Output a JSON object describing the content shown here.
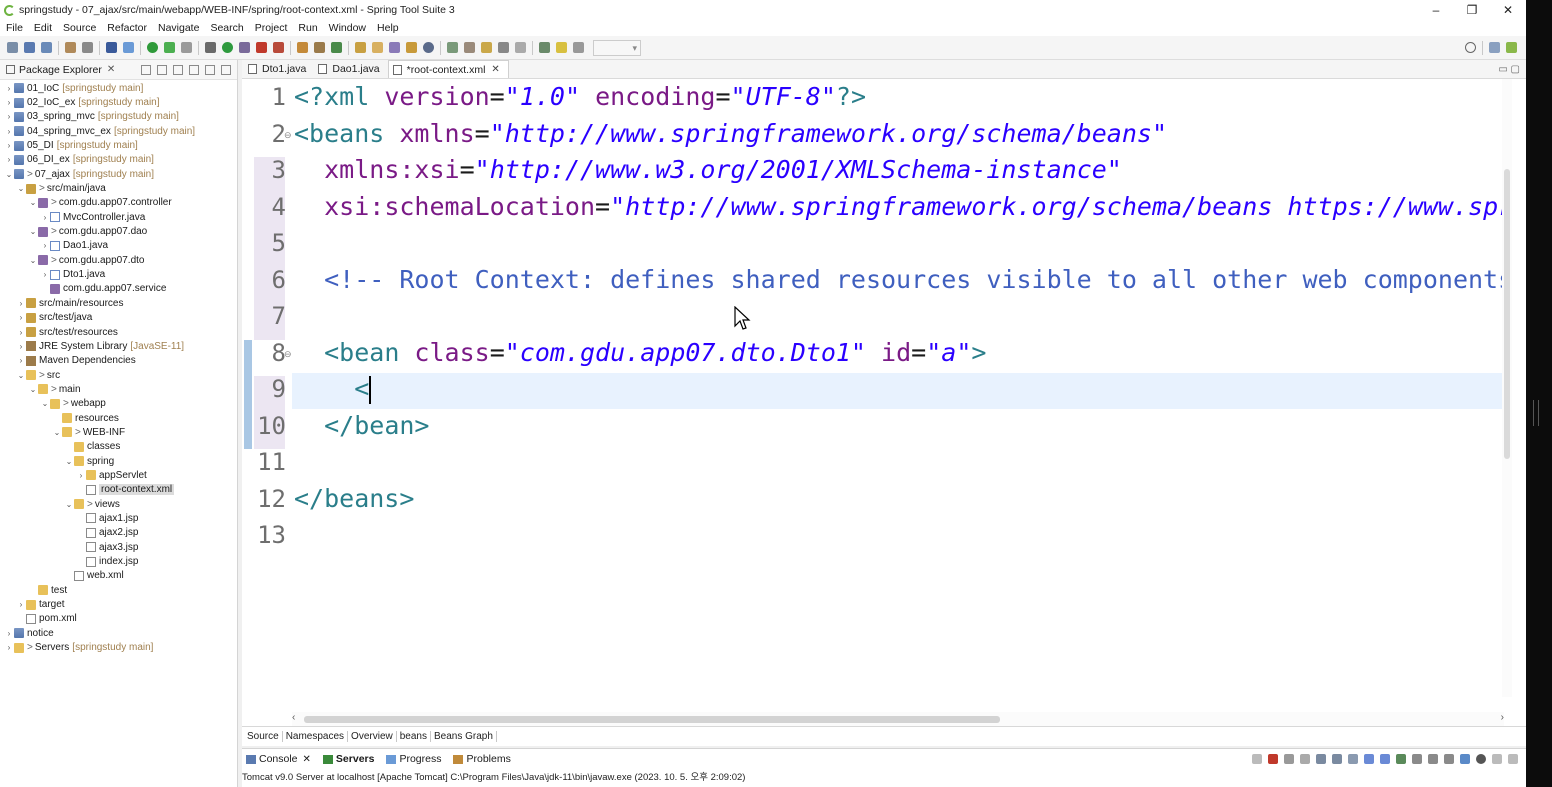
{
  "window": {
    "title": "springstudy - 07_ajax/src/main/webapp/WEB-INF/spring/root-context.xml - Spring Tool Suite 3",
    "minimize": "–",
    "restore": "❐",
    "close": "✕"
  },
  "menu": [
    "File",
    "Edit",
    "Source",
    "Refactor",
    "Navigate",
    "Search",
    "Project",
    "Run",
    "Window",
    "Help"
  ],
  "explorer": {
    "title": "Package Explorer",
    "tree": [
      {
        "label": "01_IoC",
        "ann": "[springstudy main]",
        "indent": 0,
        "arrow": ">",
        "icon": "proj"
      },
      {
        "label": "02_IoC_ex",
        "ann": "[springstudy main]",
        "indent": 0,
        "arrow": ">",
        "icon": "proj"
      },
      {
        "label": "03_spring_mvc",
        "ann": "[springstudy main]",
        "indent": 0,
        "arrow": ">",
        "icon": "proj"
      },
      {
        "label": "04_spring_mvc_ex",
        "ann": "[springstudy main]",
        "indent": 0,
        "arrow": ">",
        "icon": "proj"
      },
      {
        "label": "05_DI",
        "ann": "[springstudy main]",
        "indent": 0,
        "arrow": ">",
        "icon": "proj"
      },
      {
        "label": "06_DI_ex",
        "ann": "[springstudy main]",
        "indent": 0,
        "arrow": ">",
        "icon": "proj"
      },
      {
        "label": "07_ajax",
        "deco": ">",
        "ann": "[springstudy main]",
        "indent": 0,
        "arrow": "v",
        "icon": "proj"
      },
      {
        "label": "src/main/java",
        "deco": ">",
        "ann": "",
        "indent": 1,
        "arrow": "v",
        "icon": "srcfolder"
      },
      {
        "label": "com.gdu.app07.controller",
        "deco": ">",
        "ann": "",
        "indent": 2,
        "arrow": "v",
        "icon": "pkg"
      },
      {
        "label": "MvcController.java",
        "ann": "",
        "indent": 3,
        "arrow": ">",
        "icon": "java"
      },
      {
        "label": "com.gdu.app07.dao",
        "deco": ">",
        "ann": "",
        "indent": 2,
        "arrow": "v",
        "icon": "pkg"
      },
      {
        "label": "Dao1.java",
        "ann": "",
        "indent": 3,
        "arrow": ">",
        "icon": "java"
      },
      {
        "label": "com.gdu.app07.dto",
        "deco": ">",
        "ann": "",
        "indent": 2,
        "arrow": "v",
        "icon": "pkg"
      },
      {
        "label": "Dto1.java",
        "ann": "",
        "indent": 3,
        "arrow": ">",
        "icon": "java"
      },
      {
        "label": "com.gdu.app07.service",
        "ann": "",
        "indent": 3,
        "arrow": "",
        "icon": "pkg"
      },
      {
        "label": "src/main/resources",
        "ann": "",
        "indent": 1,
        "arrow": ">",
        "icon": "srcfolder"
      },
      {
        "label": "src/test/java",
        "ann": "",
        "indent": 1,
        "arrow": ">",
        "icon": "srcfolder"
      },
      {
        "label": "src/test/resources",
        "ann": "",
        "indent": 1,
        "arrow": ">",
        "icon": "srcfolder"
      },
      {
        "label": "JRE System Library",
        "ann": "[JavaSE-11]",
        "indent": 1,
        "arrow": ">",
        "icon": "jar"
      },
      {
        "label": "Maven Dependencies",
        "ann": "",
        "indent": 1,
        "arrow": ">",
        "icon": "jar"
      },
      {
        "label": "src",
        "deco": ">",
        "ann": "",
        "indent": 1,
        "arrow": "v",
        "icon": "folder"
      },
      {
        "label": "main",
        "deco": ">",
        "ann": "",
        "indent": 2,
        "arrow": "v",
        "icon": "folder"
      },
      {
        "label": "webapp",
        "deco": ">",
        "ann": "",
        "indent": 3,
        "arrow": "v",
        "icon": "folder"
      },
      {
        "label": "resources",
        "ann": "",
        "indent": 4,
        "arrow": "",
        "icon": "folder"
      },
      {
        "label": "WEB-INF",
        "deco": ">",
        "ann": "",
        "indent": 4,
        "arrow": "v",
        "icon": "folder"
      },
      {
        "label": "classes",
        "ann": "",
        "indent": 5,
        "arrow": "",
        "icon": "folder"
      },
      {
        "label": "spring",
        "ann": "",
        "indent": 5,
        "arrow": "v",
        "icon": "folder"
      },
      {
        "label": "appServlet",
        "ann": "",
        "indent": 6,
        "arrow": ">",
        "icon": "folder"
      },
      {
        "label": "root-context.xml",
        "ann": "",
        "indent": 6,
        "arrow": "",
        "icon": "xml",
        "selected": true
      },
      {
        "label": "views",
        "deco": ">",
        "ann": "",
        "indent": 5,
        "arrow": "v",
        "icon": "folder"
      },
      {
        "label": "ajax1.jsp",
        "ann": "",
        "indent": 6,
        "arrow": "",
        "icon": "file"
      },
      {
        "label": "ajax2.jsp",
        "ann": "",
        "indent": 6,
        "arrow": "",
        "icon": "file"
      },
      {
        "label": "ajax3.jsp",
        "ann": "",
        "indent": 6,
        "arrow": "",
        "icon": "file"
      },
      {
        "label": "index.jsp",
        "ann": "",
        "indent": 6,
        "arrow": "",
        "icon": "file"
      },
      {
        "label": "web.xml",
        "ann": "",
        "indent": 5,
        "arrow": "",
        "icon": "xml"
      },
      {
        "label": "test",
        "ann": "",
        "indent": 2,
        "arrow": "",
        "icon": "folder"
      },
      {
        "label": "target",
        "ann": "",
        "indent": 1,
        "arrow": ">",
        "icon": "folder"
      },
      {
        "label": "pom.xml",
        "ann": "",
        "indent": 1,
        "arrow": "",
        "icon": "xml"
      },
      {
        "label": "notice",
        "ann": "",
        "indent": 0,
        "arrow": ">",
        "icon": "proj"
      },
      {
        "label": "Servers",
        "deco": ">",
        "ann": "[springstudy main]",
        "indent": 0,
        "arrow": ">",
        "icon": "folder"
      }
    ]
  },
  "editor": {
    "tabs": [
      {
        "label": "Dto1.java",
        "active": false
      },
      {
        "label": "Dao1.java",
        "active": false
      },
      {
        "label": "*root-context.xml",
        "active": true
      }
    ],
    "lines": [
      {
        "n": "1",
        "html": "<span class=\"k-pi\">&lt;?xml </span><span class=\"k-attr\">version</span>=<span class=\"k-str\">\"1.0\"</span> <span class=\"k-attr\">encoding</span>=<span class=\"k-str\">\"UTF-8\"</span><span class=\"k-pi\">?&gt;</span>"
      },
      {
        "n": "2",
        "html": "<span class=\"k-tag\">&lt;beans </span><span class=\"k-attr\">xmlns</span>=<span class=\"k-str\">\"http://www.springframework.org/schema/beans\"</span>",
        "fold": true
      },
      {
        "n": "3",
        "html": "  <span class=\"k-attr\">xmlns:xsi</span>=<span class=\"k-str\">\"http://www.w3.org/2001/XMLSchema-instance\"</span>"
      },
      {
        "n": "4",
        "html": "  <span class=\"k-attr\">xsi:schemaLocation</span>=<span class=\"k-str\">\"http://www.springframework.org/schema/beans https://www.springframework.org/schema/beans/spring-beans.xsd\"</span>"
      },
      {
        "n": "5",
        "html": ""
      },
      {
        "n": "6",
        "html": "  <span class=\"k-cmt\">&lt;!-- Root Context: defines shared resources visible to all other web components --&gt;</span>"
      },
      {
        "n": "7",
        "html": ""
      },
      {
        "n": "8",
        "html": "  <span class=\"k-tag\">&lt;bean </span><span class=\"k-attr\">class</span>=<span class=\"k-str\">\"com.gdu.app07.dto.Dto1\"</span> <span class=\"k-attr\">id</span>=<span class=\"k-str\">\"a\"</span><span class=\"k-tag\">&gt;</span>",
        "fold": true
      },
      {
        "n": "9",
        "html": "    <span class=\"k-tag\">&lt;</span><span class=\"caret\"></span>",
        "current": true
      },
      {
        "n": "10",
        "html": "  <span class=\"k-tag\">&lt;/bean&gt;</span>"
      },
      {
        "n": "11",
        "html": ""
      },
      {
        "n": "12",
        "html": "<span class=\"k-tag\">&lt;/beans&gt;</span>"
      },
      {
        "n": "13",
        "html": ""
      }
    ],
    "page_tabs": [
      "Source",
      "Namespaces",
      "Overview",
      "beans",
      "Beans Graph"
    ]
  },
  "console": {
    "tabs": [
      {
        "label": "Console",
        "active": false,
        "closable": true
      },
      {
        "label": "Servers",
        "active": true,
        "closable": false
      },
      {
        "label": "Progress",
        "active": false,
        "closable": false
      },
      {
        "label": "Problems",
        "active": false,
        "closable": false
      }
    ],
    "status": "Tomcat v9.0 Server at localhost [Apache Tomcat] C:\\Program Files\\Java\\jdk-11\\bin\\javaw.exe  (2023. 10. 5. 오후 2:09:02)"
  },
  "colors": {
    "spring_green": "#6db33f",
    "tag": "#2a7e8a",
    "attr": "#7a1a86",
    "string": "#2a00ff",
    "comment": "#3f5fbf"
  }
}
